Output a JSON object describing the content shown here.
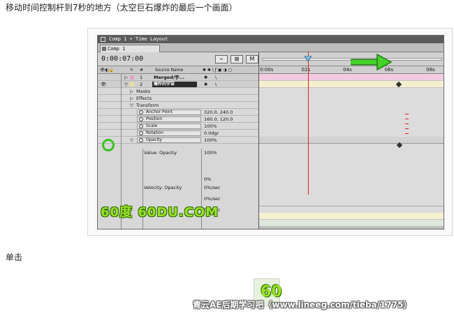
{
  "caption_top": "移动时间控制杆到7秒的地方（太空巨石爆炸的最后一个画面）",
  "caption_bottom": "单击",
  "window": {
    "title": "Comp 1 • Time Layout",
    "tab_label": "Comp 1",
    "timecode": "0:00:07:00",
    "button_m": "M"
  },
  "columns": {
    "source_name": "Source Name",
    "number_sign": "#"
  },
  "layers": [
    {
      "num": "1",
      "name": "Merged/宇..."
    },
    {
      "num": "2",
      "name": "爆炸的宇宙"
    }
  ],
  "groups": [
    "Masks",
    "Effects",
    "Transform"
  ],
  "properties": [
    {
      "name": "Anchor Point",
      "value": "320.0, 240.0"
    },
    {
      "name": "Position",
      "value": "160.0, 120.0"
    },
    {
      "name": "Scale",
      "value": "100%"
    },
    {
      "name": "Rotation",
      "value": "0.0dgr"
    },
    {
      "name": "Opacity",
      "value": "100%"
    }
  ],
  "graph": {
    "value_label": "Value: Opacity",
    "value_max": "100%",
    "value_min": "0%",
    "velocity_label": "Velocity: Opacity",
    "velocity_values": [
      "0%/sec",
      "0%/sec",
      "0%/sec"
    ]
  },
  "ruler_ticks": [
    "0:00s",
    "02s",
    "04s",
    "06s",
    "08s"
  ],
  "playhead_seconds": 7,
  "ruler_max_seconds": 8.6,
  "logo_text": "60度 60DU.COM",
  "logo_glyph": "60",
  "watermark": "青云AE后期学习吧（www.lineeg.com/tieba/1775）",
  "colors": {
    "accent_green": "#39c21e",
    "playhead_red": "#e0201c",
    "layer1_bar": "#f2cbe0",
    "layer2_bar": "#f4efcf"
  }
}
